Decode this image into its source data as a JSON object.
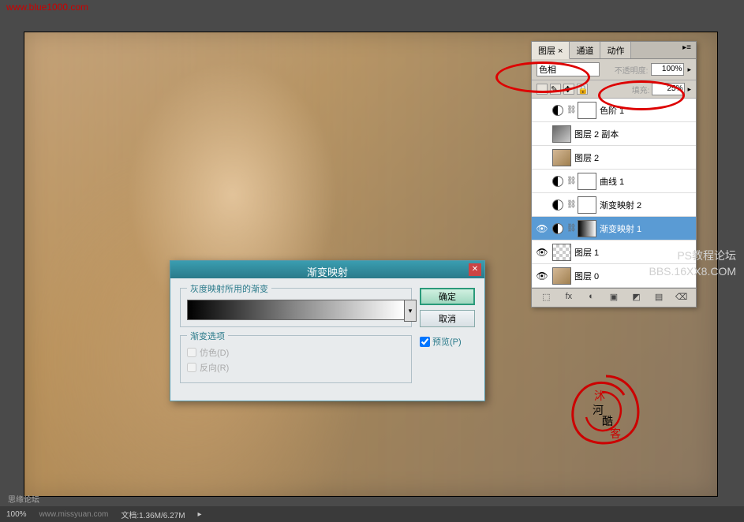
{
  "watermarks": {
    "top": "www.blue1000.com",
    "right1": "PS教程论坛",
    "right2": "BBS.16XX8.COM",
    "bottom1": "思缘论坛",
    "bottom2": "www.missyuan.com"
  },
  "panel": {
    "tabs": [
      "图层 ×",
      "通道",
      "动作"
    ],
    "blend_label": "色相",
    "opacity_label": "不透明度:",
    "opacity_value": "100%",
    "fill_label": "填充:",
    "fill_value": "25%",
    "layers": [
      {
        "name": "色阶 1",
        "type": "adj",
        "visible": false,
        "thumb": "white"
      },
      {
        "name": "图层 2 副本",
        "type": "img",
        "visible": false,
        "thumb": "bw"
      },
      {
        "name": "图层 2",
        "type": "img",
        "visible": false,
        "thumb": "photo"
      },
      {
        "name": "曲线 1",
        "type": "adj",
        "visible": false,
        "thumb": "white"
      },
      {
        "name": "渐变映射 2",
        "type": "adj",
        "visible": false,
        "thumb": "white"
      },
      {
        "name": "渐变映射 1",
        "type": "adj",
        "visible": true,
        "thumb": "gradient",
        "selected": true
      },
      {
        "name": "图层 1",
        "type": "img",
        "visible": true,
        "thumb": "checker"
      },
      {
        "name": "图层 0",
        "type": "img",
        "visible": true,
        "thumb": "photo"
      }
    ],
    "bottom_icons": [
      "⬚",
      "fx",
      "◐",
      "▣",
      "◩",
      "▤",
      "⌫"
    ]
  },
  "dialog": {
    "title": "渐变映射",
    "group1_label": "灰度映射所用的渐变",
    "group2_label": "渐变选项",
    "dither": "仿色(D)",
    "reverse": "反向(R)",
    "ok": "确定",
    "cancel": "取消",
    "preview": "预览(P)"
  },
  "status": {
    "zoom": "100%",
    "doc": "文档:1.36M/6.27M"
  }
}
